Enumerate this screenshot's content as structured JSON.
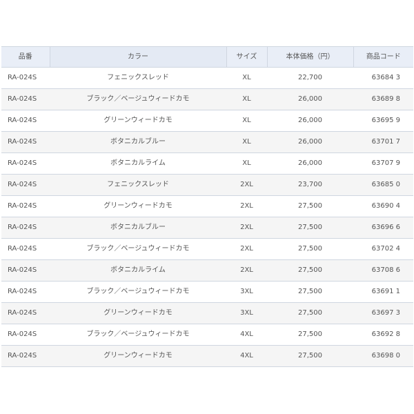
{
  "table": {
    "headers": {
      "code": "品番",
      "color": "カラー",
      "size": "サイズ",
      "price": "本体価格（円）",
      "product_code": "商品コード"
    },
    "rows": [
      {
        "code": "RA-024S",
        "color": "フェニックスレッド",
        "size": "XL",
        "price": "22,700",
        "product_code": "63684 3"
      },
      {
        "code": "RA-024S",
        "color": "ブラック／ベージュウィードカモ",
        "size": "XL",
        "price": "26,000",
        "product_code": "63689 8"
      },
      {
        "code": "RA-024S",
        "color": "グリーンウィードカモ",
        "size": "XL",
        "price": "26,000",
        "product_code": "63695 9"
      },
      {
        "code": "RA-024S",
        "color": "ボタニカルブルー",
        "size": "XL",
        "price": "26,000",
        "product_code": "63701 7"
      },
      {
        "code": "RA-024S",
        "color": "ボタニカルライム",
        "size": "XL",
        "price": "26,000",
        "product_code": "63707 9"
      },
      {
        "code": "RA-024S",
        "color": "フェニックスレッド",
        "size": "2XL",
        "price": "23,700",
        "product_code": "63685 0"
      },
      {
        "code": "RA-024S",
        "color": "グリーンウィードカモ",
        "size": "2XL",
        "price": "27,500",
        "product_code": "63690 4"
      },
      {
        "code": "RA-024S",
        "color": "ボタニカルブルー",
        "size": "2XL",
        "price": "27,500",
        "product_code": "63696 6"
      },
      {
        "code": "RA-024S",
        "color": "ブラック／ベージュウィードカモ",
        "size": "2XL",
        "price": "27,500",
        "product_code": "63702 4"
      },
      {
        "code": "RA-024S",
        "color": "ボタニカルライム",
        "size": "2XL",
        "price": "27,500",
        "product_code": "63708 6"
      },
      {
        "code": "RA-024S",
        "color": "ブラック／ベージュウィードカモ",
        "size": "3XL",
        "price": "27,500",
        "product_code": "63691 1"
      },
      {
        "code": "RA-024S",
        "color": "グリーンウィードカモ",
        "size": "3XL",
        "price": "27,500",
        "product_code": "63697 3"
      },
      {
        "code": "RA-024S",
        "color": "ブラック／ベージュウィードカモ",
        "size": "4XL",
        "price": "27,500",
        "product_code": "63692 8"
      },
      {
        "code": "RA-024S",
        "color": "グリーンウィードカモ",
        "size": "4XL",
        "price": "27,500",
        "product_code": "63698 0"
      }
    ]
  },
  "colors": {
    "header_bg": "#e9eef7",
    "border": "#cfd6e0",
    "row_alt": "#f5f5f5",
    "text": "#555555"
  }
}
